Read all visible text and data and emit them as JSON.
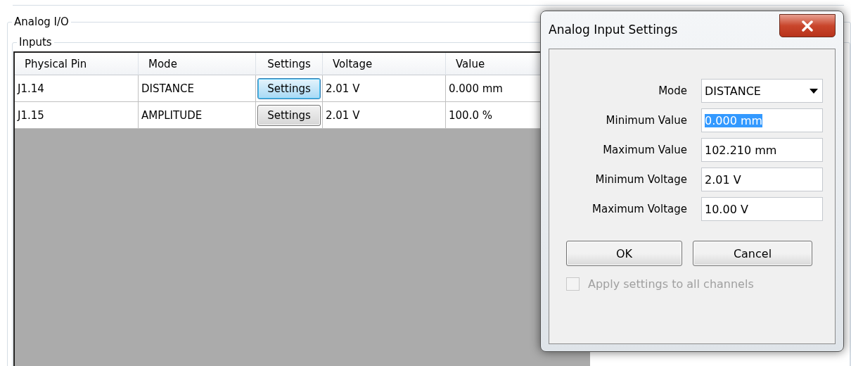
{
  "groups": {
    "outer_title": "Analog I/O",
    "inner_title": "Inputs"
  },
  "table": {
    "columns": [
      "Physical Pin",
      "Mode",
      "Settings",
      "Voltage",
      "Value"
    ],
    "rows": [
      {
        "pin": "J1.14",
        "mode": "DISTANCE",
        "settings_button": "Settings",
        "selected": true,
        "voltage": "2.01 V",
        "value": "0.000 mm"
      },
      {
        "pin": "J1.15",
        "mode": "AMPLITUDE",
        "settings_button": "Settings",
        "selected": false,
        "voltage": "2.01 V",
        "value": "100.0 %"
      }
    ]
  },
  "dialog": {
    "title": "Analog Input Settings",
    "fields": [
      {
        "label": "Mode",
        "kind": "dropdown",
        "value": "DISTANCE",
        "selected": false
      },
      {
        "label": "Minimum Value",
        "kind": "text",
        "value": "0.000 mm",
        "selected": true
      },
      {
        "label": "Maximum Value",
        "kind": "text",
        "value": "102.210 mm",
        "selected": false
      },
      {
        "label": "Minimum Voltage",
        "kind": "text",
        "value": "2.01 V",
        "selected": false
      },
      {
        "label": "Maximum Voltage",
        "kind": "text",
        "value": "10.00 V",
        "selected": false
      }
    ],
    "buttons": [
      "OK",
      "Cancel"
    ],
    "checkbox": {
      "label": "Apply settings to all channels",
      "checked": false,
      "disabled": true
    }
  }
}
